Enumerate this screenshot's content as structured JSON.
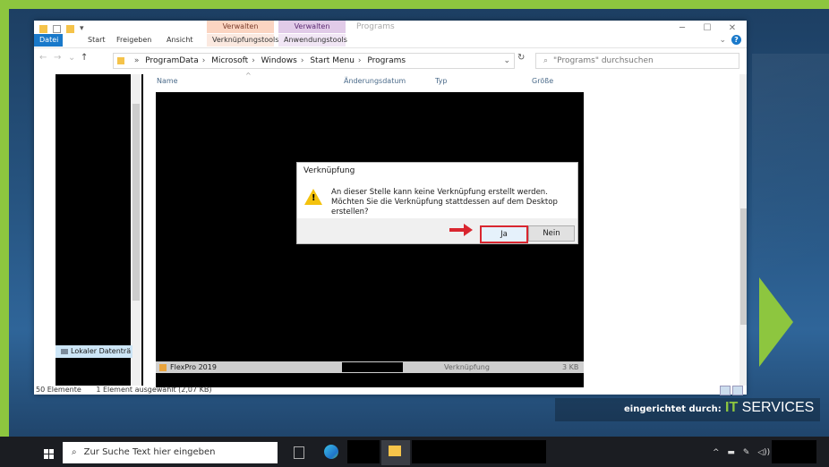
{
  "ribbon": {
    "context_headers": [
      "Verwalten",
      "Verwalten"
    ],
    "window_title": "Programs",
    "tabs": [
      "Datei",
      "Start",
      "Freigeben",
      "Ansicht",
      "Verknüpfungstools",
      "Anwendungstools"
    ]
  },
  "address": {
    "crumbs": [
      "ProgramData",
      "Microsoft",
      "Windows",
      "Start Menu",
      "Programs"
    ],
    "search_placeholder": "\"Programs\" durchsuchen"
  },
  "columns": [
    "Name",
    "Änderungsdatum",
    "Typ",
    "Größe"
  ],
  "navpane": {
    "drive_label": "Lokaler Datenträ"
  },
  "file": {
    "name": "FlexPro 2019",
    "type": "Verknüpfung",
    "size": "3 KB"
  },
  "status": {
    "count": "50 Elemente",
    "selection": "1 Element ausgewählt (2,07 KB)"
  },
  "dialog": {
    "title": "Verknüpfung",
    "line1": "An dieser Stelle kann keine Verknüpfung erstellt werden.",
    "line2": "Möchten Sie die Verknüpfung stattdessen auf dem Desktop erstellen?",
    "yes": "Ja",
    "no": "Nein"
  },
  "taskbar": {
    "search_placeholder": "Zur Suche Text hier eingeben"
  },
  "branding": {
    "label": "eingerichtet durch:",
    "logo_a": "IT",
    "logo_b": "SERVICES"
  },
  "colors": {
    "frame_green": "#8dc63f",
    "accent_blue": "#1979ca",
    "arrow_red": "#d9262f",
    "warning_yellow": "#f4c20d"
  }
}
